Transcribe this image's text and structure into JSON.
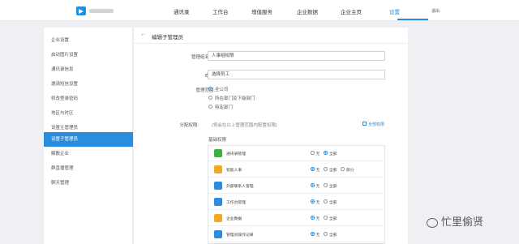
{
  "topbar": {
    "nav": [
      "通讯录",
      "工作台",
      "增值服务",
      "企业数据",
      "企业主页",
      "设置"
    ],
    "active_nav": "设置",
    "logout": "退出"
  },
  "sidebar": {
    "items": [
      "企业设置",
      "启动图片设置",
      "通讯录信息",
      "邀请短信设置",
      "修改登录密码",
      "地区与时区",
      "设置主管理员",
      "设置子管理员",
      "解散企业",
      "群直播管理",
      "聊天管理"
    ],
    "active": "设置子管理员"
  },
  "page": {
    "back": "←",
    "title": "编辑子管理员",
    "name_label": "管理组名称:",
    "name_value": "人事组权限",
    "members_label": "成员:",
    "members_value": "选择员工",
    "scope_label": "管理范围:",
    "scope_options": [
      "全公司",
      "所在部门及下级部门",
      "特定部门"
    ],
    "scope_selected": "全公司",
    "perm_label": "分配权限:",
    "perm_hint": "(将会在以上管理范围内配置权限)",
    "check_all": "全部权限",
    "section": "基础权限",
    "permissions": [
      {
        "name": "通讯录管理",
        "icon": "contacts-icon",
        "color": "#3ab03e",
        "options": [
          "无",
          "全部"
        ],
        "selected": "全部"
      },
      {
        "name": "智能人事",
        "icon": "hr-icon",
        "color": "#f5a623",
        "options": [
          "无",
          "全部",
          "部分"
        ],
        "selected": "无"
      },
      {
        "name": "外部联系人管理",
        "icon": "external-contacts-icon",
        "color": "#2a8de0",
        "options": [
          "无",
          "全部"
        ],
        "selected": "无"
      },
      {
        "name": "工作台管理",
        "icon": "workbench-icon",
        "color": "#2a8de0",
        "options": [
          "无",
          "全部"
        ],
        "selected": "无"
      },
      {
        "name": "企业数据",
        "icon": "data-icon",
        "color": "#f5a623",
        "options": [
          "无",
          "全部"
        ],
        "selected": "无"
      },
      {
        "name": "管理员操作记录",
        "icon": "log-icon",
        "color": "#2a8de0",
        "options": [
          "无",
          "全部"
        ],
        "selected": "无"
      }
    ]
  },
  "watermark": "忙里偷贤"
}
